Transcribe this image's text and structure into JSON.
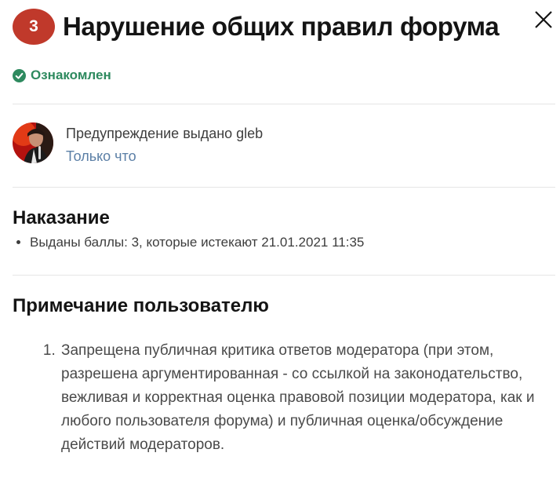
{
  "header": {
    "points_badge": "3",
    "title": "Нарушение общих правил форума",
    "close_icon": "close-icon"
  },
  "status": {
    "label": "Ознакомлен",
    "icon": "check-circle-icon",
    "color": "#2e8a5f"
  },
  "author": {
    "issued_text": "Предупреждение выдано gleb",
    "time": "Только что",
    "avatar": "avatar"
  },
  "penalty": {
    "heading": "Наказание",
    "items": [
      "Выданы баллы: 3, которые истекают 21.01.2021 11:35"
    ]
  },
  "user_note": {
    "heading": "Примечание пользователю",
    "items": [
      "Запрещена публичная критика ответов модератора (при этом, разрешена аргументированная - со ссылкой на законодательство, вежливая и корректная оценка правовой позиции модератора, как и любого пользователя форума) и публичная оценка/обсуждение действий модераторов."
    ]
  },
  "colors": {
    "badge": "#c0392b",
    "link": "#5b7fa6",
    "divider": "#e5e5e5"
  }
}
